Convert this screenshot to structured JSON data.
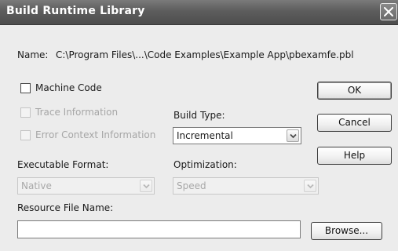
{
  "window": {
    "title": "Build Runtime Library",
    "close_icon": "close-x-icon"
  },
  "name": {
    "label": "Name:",
    "value": "C:\\Program Files\\...\\Code Examples\\Example App\\pbexamfe.pbl"
  },
  "options": {
    "machine_code": {
      "label": "Machine Code",
      "checked": false,
      "enabled": true
    },
    "trace_information": {
      "label": "Trace Information",
      "checked": false,
      "enabled": false
    },
    "error_context": {
      "label": "Error Context Information",
      "checked": false,
      "enabled": false
    }
  },
  "build_type": {
    "label": "Build Type:",
    "value": "Incremental",
    "enabled": true
  },
  "executable_format": {
    "label": "Executable Format:",
    "value": "Native",
    "enabled": false
  },
  "optimization": {
    "label": "Optimization:",
    "value": "Speed",
    "enabled": false
  },
  "resource_file": {
    "label": "Resource File Name:",
    "value": "",
    "browse_label": "Browse..."
  },
  "buttons": {
    "ok": "OK",
    "cancel": "Cancel",
    "help": "Help"
  },
  "colors": {
    "titlebar": "#5d5d5d",
    "dialog_bg": "#ececec",
    "disabled_text": "#a6a6a6"
  }
}
